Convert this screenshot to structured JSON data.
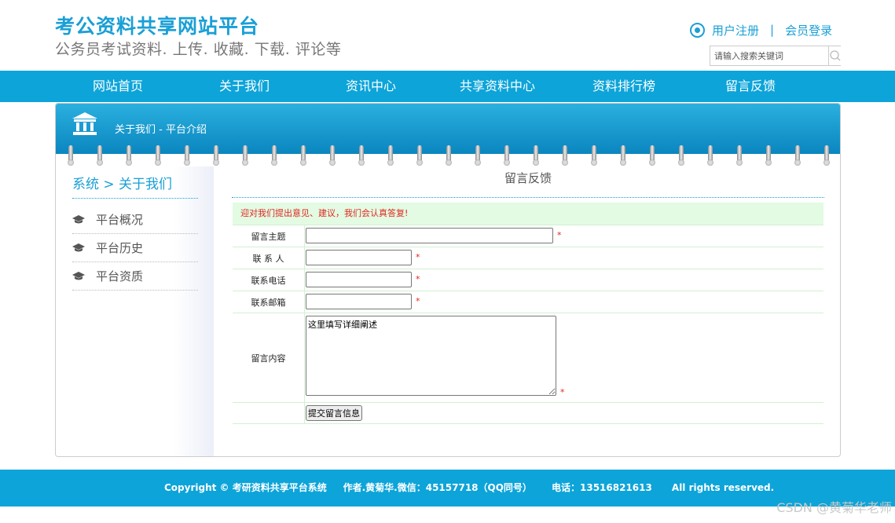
{
  "header": {
    "title": "考公资料共享网站平台",
    "subtitle": "公务员考试资料. 上传. 收藏. 下载. 评论等",
    "register_label": "用户注册",
    "separator": "|",
    "login_label": "会员登录",
    "search_placeholder": "请输入搜索关键词",
    "accent_color": "#1a9fd6"
  },
  "nav": {
    "items": [
      {
        "label": "网站首页"
      },
      {
        "label": "关于我们"
      },
      {
        "label": "资讯中心"
      },
      {
        "label": "共享资料中心"
      },
      {
        "label": "资料排行榜"
      },
      {
        "label": "留言反馈"
      }
    ],
    "bg_color": "#0da4d9"
  },
  "panel": {
    "head_title": "关于我们 - 平台介绍",
    "head_icon": "bank-icon"
  },
  "sidebar": {
    "breadcrumb": "系统 > 关于我们",
    "items": [
      {
        "label": "平台概况",
        "icon": "graduation-cap-icon"
      },
      {
        "label": "平台历史",
        "icon": "graduation-cap-icon"
      },
      {
        "label": "平台资质",
        "icon": "graduation-cap-icon"
      }
    ]
  },
  "form": {
    "title": "留言反馈",
    "notice": "迎对我们提出意见、建议，我们会认真答复!",
    "fields": {
      "subject_label": "留言主题",
      "contact_label": "联 系 人",
      "phone_label": "联系电话",
      "email_label": "联系邮箱",
      "content_label": "留言内容"
    },
    "content_value": "这里填写详细阐述",
    "required_mark": "*",
    "submit_label": "提交留言信息"
  },
  "footer": {
    "text": "Copyright © 考研资料共享平台系统     作者.黄菊华.微信：45157718（QQ同号）      电话：13516821613      All rights reserved."
  },
  "watermark": "CSDN @黄菊华老师"
}
